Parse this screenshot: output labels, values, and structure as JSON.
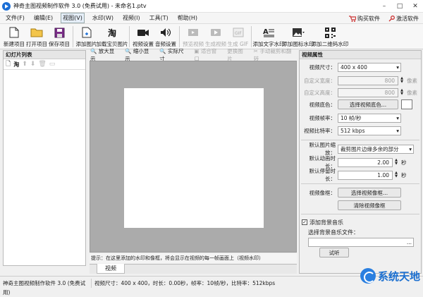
{
  "window": {
    "title": "神奇主图视频制作软件 3.0 (免费试用) - 未命名1.ptv",
    "min": "–",
    "max": "□",
    "close": "✕"
  },
  "menu": {
    "items": [
      "文件(F)",
      "编辑(E)",
      "视图(V)",
      "水印(W)",
      "视频(I)",
      "工具(T)",
      "帮助(H)"
    ],
    "buy": "购买软件",
    "activate": "激活软件"
  },
  "toolbar": {
    "items": [
      "新建项目",
      "打开项目",
      "保存项目",
      "添加图片",
      "加载宝贝图片",
      "视频设置",
      "音频设置",
      "预览视频",
      "生成视频",
      "生成 GIF",
      "添加文字水印",
      "添加图标水印",
      "添加二维码水印"
    ]
  },
  "slides": {
    "title": "幻灯片列表"
  },
  "viewtools": {
    "zoom_in": "放大显示",
    "zoom_out": "缩小显示",
    "actual": "实际尺寸",
    "fit": "适合窗口",
    "replace": "更换图片",
    "crop": "手动裁剪和翻转"
  },
  "hint": "提示：在这里添加的水印和像框，将会显示在视频的每一帧画面上（视频水印）",
  "tabs": {
    "video": "视频"
  },
  "props": {
    "title": "视频属性",
    "size_label": "视频尺寸：",
    "size_value": "400 x 400",
    "custom_width_label": "自定义宽度：",
    "custom_width": "800",
    "custom_height_label": "自定义高度：",
    "custom_height": "800",
    "unit_px": "像素",
    "bg_label": "视频底色：",
    "bg_button": "选择视频底色...",
    "fps_label": "视频帧率：",
    "fps_value": "10 帧/秒",
    "bitrate_label": "视频比特率：",
    "bitrate_value": "512 kbps",
    "scale_label": "默认图片缩放：",
    "scale_value": "裁剪图片边缘多余的部分",
    "anim_label": "默认动画时长：",
    "anim_value": "2.00",
    "pause_label": "默认停留时长：",
    "pause_value": "1.00",
    "unit_sec": "秒",
    "frame_label": "视频像框：",
    "frame_button": "选择视频像框...",
    "clear_frame_button": "清除视频像框",
    "music_check": "添加背景音乐",
    "music_file_label": "选择背景音乐文件：",
    "music_browse": "...",
    "listen_button": "试听"
  },
  "status": {
    "app": "神奇主图视频制作软件 3.0 (免费试用)",
    "info": "视频尺寸：400 x 400，时长：0.00秒，帧率：10帧/秒，比特率：512kbps"
  },
  "watermark": "系统天地"
}
